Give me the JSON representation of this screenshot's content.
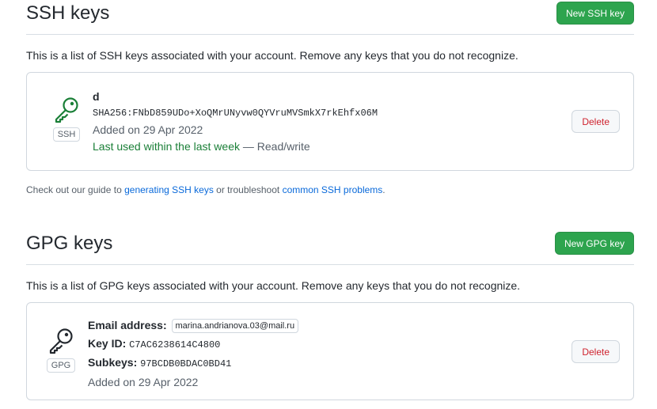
{
  "ssh": {
    "title": "SSH keys",
    "new_button": "New SSH key",
    "intro": "This is a list of SSH keys associated with your account. Remove any keys that you do not recognize.",
    "key": {
      "icon": "key-icon",
      "badge": "SSH",
      "name": "d",
      "fingerprint": "SHA256:FNbD859UDo+XoQMrUNyvw0QYVruMVSmkX7rkEhfx06M",
      "added": "Added on 29 Apr 2022",
      "last_used": "Last used within the last week",
      "access": "— Read/write",
      "delete_label": "Delete"
    },
    "guide": {
      "prefix": "Check out our guide to",
      "link1": "generating SSH keys",
      "middle": "or troubleshoot",
      "link2": "common SSH problems",
      "suffix": "."
    }
  },
  "gpg": {
    "title": "GPG keys",
    "new_button": "New GPG key",
    "intro": "This is a list of GPG keys associated with your account. Remove any keys that you do not recognize.",
    "key": {
      "icon": "key-icon",
      "badge": "GPG",
      "email_label": "Email address:",
      "email": "marina.andrianova.03@mail.ru",
      "keyid_label": "Key ID:",
      "keyid": "C7AC6238614C4800",
      "subkeys_label": "Subkeys:",
      "subkeys": "97BCDB0BDAC0BD41",
      "added": "Added on 29 Apr 2022",
      "delete_label": "Delete"
    }
  },
  "colors": {
    "primary_button": "#2da44e",
    "danger_text": "#cf222e",
    "link": "#0969da",
    "success_text": "#1a7f37"
  }
}
